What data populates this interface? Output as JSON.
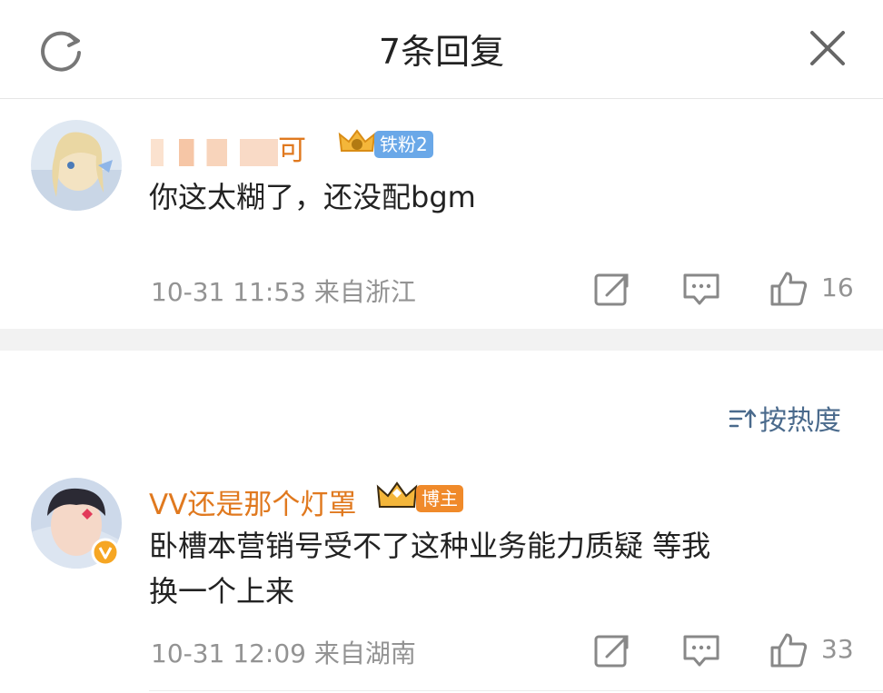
{
  "header": {
    "title": "7条回复"
  },
  "comment1": {
    "username": "可",
    "badge": "铁粉2",
    "text": "你这太糊了，还没配bgm",
    "time": "10-31 11:53",
    "location": "来自浙江",
    "likes": "16"
  },
  "sort": {
    "label": "按热度"
  },
  "comment2": {
    "username": "VV还是那个灯罩",
    "badge": "博主",
    "text_line1": "卧槽本营销号受不了这种业务能力质疑 等我",
    "text_line2": "换一个上来",
    "time": "10-31 12:09",
    "location": "来自湖南",
    "likes": "33"
  },
  "colors": {
    "name_orange": "#e0791f",
    "badge_blue": "#6aa8e8",
    "badge_orange": "#f08a2a",
    "meta_gray": "#939393"
  }
}
